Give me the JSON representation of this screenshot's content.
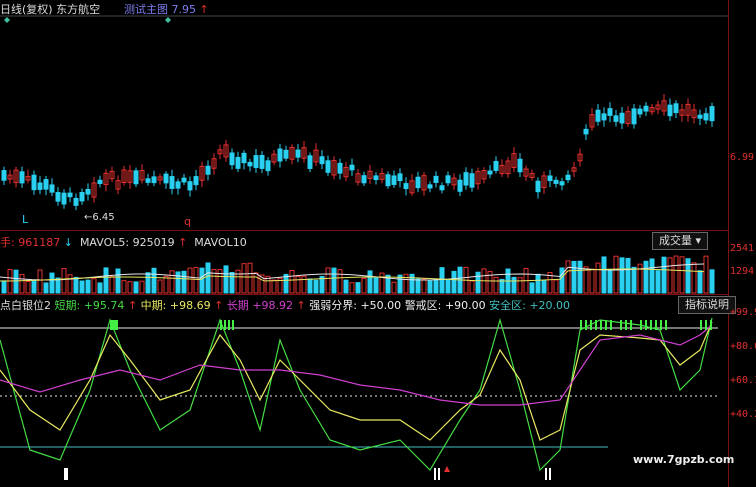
{
  "header": {
    "main_label": "日线(复权) 东方航空",
    "indicator_label": "测试主图",
    "indicator_value": "7.95",
    "indicator_arrow": "↑"
  },
  "price_panel": {
    "low_marker": "←6.45",
    "l_marker": "L",
    "q_marker": "q",
    "axis_label": "6.99"
  },
  "volume_panel": {
    "vol_label": "手:",
    "vol_value": "961187",
    "vol_arrow": "↓",
    "mavol5_label": "MAVOL5:",
    "mavol5_value": "925019",
    "mavol5_arrow": "↑",
    "mavol10_label": "MAVOL10",
    "button_label": "成交量",
    "axis_top": "2541",
    "axis_mid": "1294"
  },
  "osc_panel": {
    "name": "点白银位2",
    "short_label": "短期:",
    "short_value": "+95.74",
    "short_arrow": "↑",
    "mid_label": "中期:",
    "mid_value": "+98.69",
    "mid_arrow": "↑",
    "long_label": "长期",
    "long_value": "+98.92",
    "long_arrow": "↑",
    "strong_label": "强弱分界:",
    "strong_value": "+50.00",
    "warn_label": "警戒区:",
    "warn_value": "+90.00",
    "safe_label": "安全区:",
    "safe_value": "+20.00",
    "button_label": "指标说明",
    "axis": [
      "+99.9",
      "+80.0",
      "+60.1",
      "+40.2"
    ]
  },
  "watermark": "www.7gpzb.com",
  "colors": {
    "up": "#e23030",
    "down": "#2ad0f0",
    "short_line": "#44dd44",
    "mid_line": "#e8e860",
    "long_line": "#d040d0",
    "ref_line": "#e8e8e8",
    "safe_line": "#40c0c0"
  }
}
